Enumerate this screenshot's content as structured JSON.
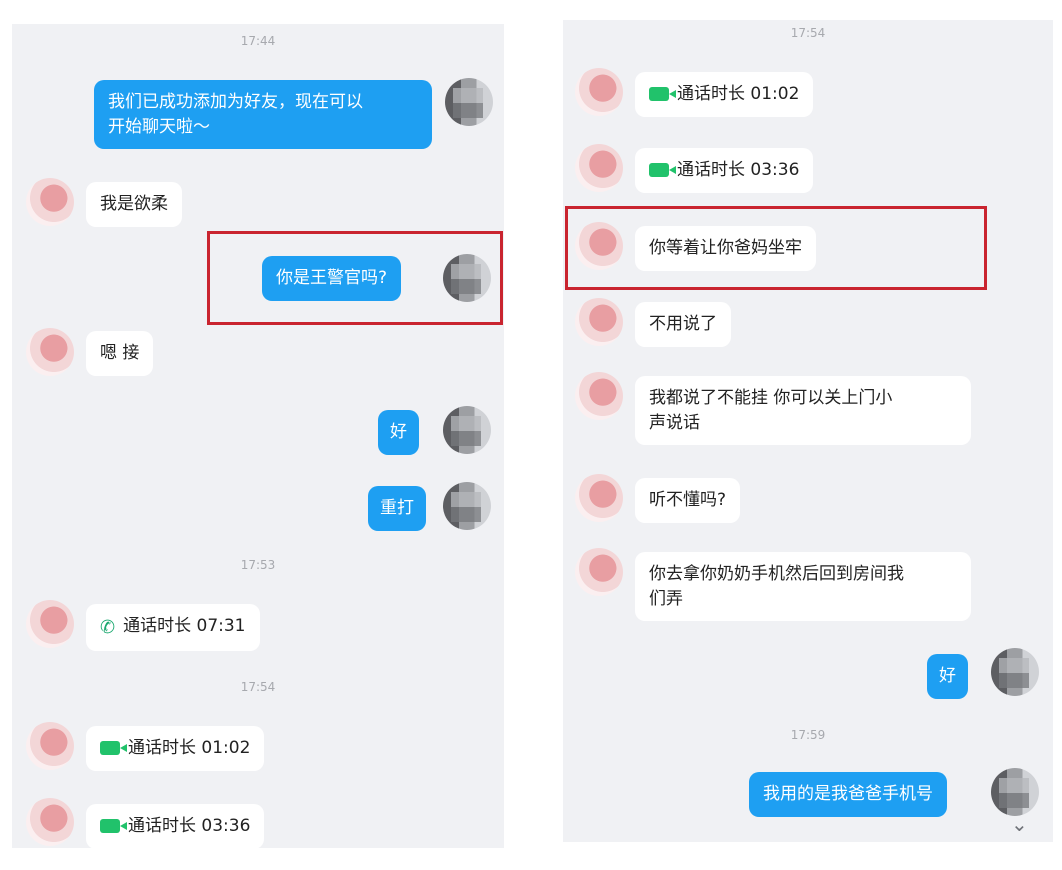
{
  "left": {
    "time_1": "17:44",
    "msg_add_friend": "我们已成功添加为好友，现在可以\n开始聊天啦～",
    "msg_i_am": "我是欲柔",
    "msg_are_you": "你是王警官吗?",
    "msg_connect": "嗯 接",
    "msg_ok": "好",
    "msg_redial": "重打",
    "time_2": "17:53",
    "call_1": "通话时长 07:31",
    "time_3": "17:54",
    "call_2": "通话时长 01:02",
    "call_3": "通话时长 03:36"
  },
  "right": {
    "time_1": "17:54",
    "call_1": "通话时长 01:02",
    "call_2": "通话时长 03:36",
    "msg_jail": "你等着让你爸妈坐牢",
    "msg_no_need": "不用说了",
    "msg_close_door": "我都说了不能挂 你可以关上门小\n声说话",
    "msg_understand": "听不懂吗?",
    "msg_grandma": "你去拿你奶奶手机然后回到房间我\n们弄",
    "msg_ok": "好",
    "time_2": "17:59",
    "msg_dad_phone": "我用的是我爸爸手机号"
  },
  "icons": {
    "video_call": "video-call-icon",
    "phone_call": "phone-call-icon",
    "dropdown": "chevron-down-icon"
  },
  "colors": {
    "self_bubble": "#1e9ff2",
    "highlight_box": "#c9242f",
    "call_icon": "#21c26b"
  }
}
